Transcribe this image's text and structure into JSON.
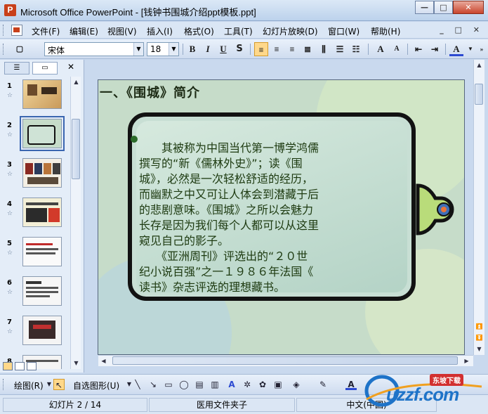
{
  "window": {
    "title": "Microsoft Office PowerPoint - [钱钟书围城介绍ppt模板.ppt]",
    "app_icon": "P",
    "min": "—",
    "max": "□",
    "close": "✕"
  },
  "menu": {
    "items": [
      "文件(F)",
      "编辑(E)",
      "视图(V)",
      "插入(I)",
      "格式(O)",
      "工具(T)",
      "幻灯片放映(D)",
      "窗口(W)",
      "帮助(H)"
    ],
    "mdi_controls": "_ □ ✕"
  },
  "format_toolbar": {
    "font_name": "宋体",
    "font_size": "18",
    "bold": "B",
    "italic": "I",
    "underline": "U",
    "shadow": "S",
    "font_grow": "A",
    "font_shrink": "A",
    "font_color": "A"
  },
  "panel": {
    "close": "✕",
    "slides": [
      {
        "num": "1"
      },
      {
        "num": "2",
        "selected": true
      },
      {
        "num": "3"
      },
      {
        "num": "4"
      },
      {
        "num": "5"
      },
      {
        "num": "6"
      },
      {
        "num": "7"
      },
      {
        "num": "8"
      }
    ],
    "star": "☆"
  },
  "slide": {
    "title": "一、《围城》简介",
    "body": "　　其被称为中国当代第一博学鸿儒\n撰写的“新《儒林外史》”；读《围\n城》，必然是一次轻松舒适的经历，\n而幽默之中又可让人体会到潜藏于后\n的悲剧意味。《围城》之所以会魅力\n长存是因为我们每个人都可以从这里\n窥见自己的影子。\n　　《亚洲周刊》评选出的“２０世\n纪小说百强”之一１９８６年法国《\n读书》杂志评选的理想藏书。"
  },
  "draw_toolbar": {
    "draw_label": "绘图(R)",
    "autoshape_label": "自选图形(U)"
  },
  "status": {
    "slide_info": "幻灯片 2 / 14",
    "template": "医用文件夹子",
    "language": "中文(中国)"
  },
  "watermark": {
    "text": "uzzf.com",
    "tag": "东坡下载"
  },
  "colors": {
    "accent": "#3a66b0",
    "slide_bg": "#c6dcc9",
    "body_text": "#1d3a10"
  }
}
